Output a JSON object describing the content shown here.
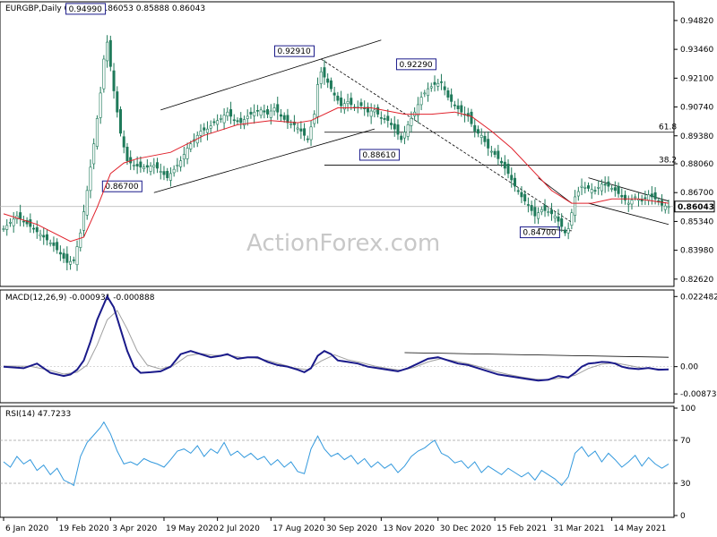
{
  "header": {
    "main_title": "EURGBP,Daily  0.85905 0.86053 0.85888 0.86043",
    "macd_title": "MACD(12,26,9) -0.000931 -0.000888",
    "rsi_title": "RSI(14) 47.7233"
  },
  "watermark": "ActionForex.com",
  "colors": {
    "candle": "#1f7a5a",
    "sma": "#e0202a",
    "macd_line": "#1a1a8a",
    "signal_line": "#a0a0a0",
    "rsi_line": "#3399dd",
    "trendline": "#000000",
    "fib_line": "#000000"
  },
  "chart_data": [
    {
      "type": "candlestick",
      "x_labels": [
        "6 Jan 2020",
        "19 Feb 2020",
        "3 Apr 2020",
        "19 May 2020",
        "2 Jul 2020",
        "17 Aug 2020",
        "30 Sep 2020",
        "13 Nov 2020",
        "30 Dec 2020",
        "15 Feb 2021",
        "31 Mar 2021",
        "14 May 2021"
      ],
      "y_ticks": [
        "0.94820",
        "0.93460",
        "0.92100",
        "0.90740",
        "0.89380",
        "0.88060",
        "0.86700",
        "0.85340",
        "0.83980",
        "0.82620"
      ],
      "ylim": [
        0.8236,
        0.9545
      ],
      "current_price_label": "0.86043",
      "close_path": [
        [
          0,
          0.85
        ],
        [
          4,
          0.856
        ],
        [
          8,
          0.851
        ],
        [
          12,
          0.846
        ],
        [
          15,
          0.842
        ],
        [
          17,
          0.838
        ],
        [
          19,
          0.834
        ],
        [
          21,
          0.835
        ],
        [
          23,
          0.848
        ],
        [
          25,
          0.868
        ],
        [
          27,
          0.89
        ],
        [
          29,
          0.914
        ],
        [
          30,
          0.93
        ],
        [
          31,
          0.938
        ],
        [
          33,
          0.915
        ],
        [
          35,
          0.895
        ],
        [
          37,
          0.882
        ],
        [
          39,
          0.88
        ],
        [
          41,
          0.879
        ],
        [
          43,
          0.879
        ],
        [
          45,
          0.88
        ],
        [
          47,
          0.877
        ],
        [
          49,
          0.874
        ],
        [
          51,
          0.878
        ],
        [
          53,
          0.882
        ],
        [
          55,
          0.888
        ],
        [
          57,
          0.892
        ],
        [
          59,
          0.896
        ],
        [
          61,
          0.897
        ],
        [
          63,
          0.9
        ],
        [
          65,
          0.902
        ],
        [
          67,
          0.905
        ],
        [
          69,
          0.901
        ],
        [
          71,
          0.9
        ],
        [
          73,
          0.903
        ],
        [
          75,
          0.905
        ],
        [
          77,
          0.906
        ],
        [
          79,
          0.904
        ],
        [
          81,
          0.907
        ],
        [
          83,
          0.903
        ],
        [
          85,
          0.9
        ],
        [
          87,
          0.899
        ],
        [
          89,
          0.896
        ],
        [
          91,
          0.892
        ],
        [
          93,
          0.904
        ],
        [
          94,
          0.918
        ],
        [
          95,
          0.924
        ],
        [
          97,
          0.919
        ],
        [
          99,
          0.913
        ],
        [
          101,
          0.908
        ],
        [
          103,
          0.91
        ],
        [
          105,
          0.907
        ],
        [
          107,
          0.908
        ],
        [
          109,
          0.905
        ],
        [
          111,
          0.906
        ],
        [
          113,
          0.902
        ],
        [
          115,
          0.901
        ],
        [
          117,
          0.897
        ],
        [
          119,
          0.892
        ],
        [
          121,
          0.899
        ],
        [
          123,
          0.905
        ],
        [
          125,
          0.912
        ],
        [
          127,
          0.916
        ],
        [
          129,
          0.918
        ],
        [
          131,
          0.919
        ],
        [
          133,
          0.912
        ],
        [
          135,
          0.908
        ],
        [
          137,
          0.905
        ],
        [
          139,
          0.903
        ],
        [
          141,
          0.896
        ],
        [
          143,
          0.894
        ],
        [
          145,
          0.888
        ],
        [
          147,
          0.885
        ],
        [
          149,
          0.881
        ],
        [
          151,
          0.876
        ],
        [
          153,
          0.87
        ],
        [
          155,
          0.865
        ],
        [
          157,
          0.861
        ],
        [
          159,
          0.856
        ],
        [
          161,
          0.859
        ],
        [
          163,
          0.858
        ],
        [
          165,
          0.856
        ],
        [
          167,
          0.851
        ],
        [
          168,
          0.848
        ],
        [
          169,
          0.85
        ],
        [
          171,
          0.865
        ],
        [
          173,
          0.87
        ],
        [
          175,
          0.869
        ],
        [
          177,
          0.868
        ],
        [
          179,
          0.871
        ],
        [
          181,
          0.87
        ],
        [
          183,
          0.868
        ],
        [
          185,
          0.865
        ],
        [
          187,
          0.862
        ],
        [
          189,
          0.865
        ],
        [
          191,
          0.863
        ],
        [
          193,
          0.866
        ],
        [
          195,
          0.864
        ],
        [
          197,
          0.861
        ],
        [
          199,
          0.8604
        ]
      ],
      "sma_path": [
        [
          0,
          0.857
        ],
        [
          10,
          0.852
        ],
        [
          20,
          0.844
        ],
        [
          24,
          0.846
        ],
        [
          28,
          0.86
        ],
        [
          32,
          0.876
        ],
        [
          36,
          0.881
        ],
        [
          40,
          0.883
        ],
        [
          50,
          0.886
        ],
        [
          60,
          0.894
        ],
        [
          70,
          0.899
        ],
        [
          80,
          0.901
        ],
        [
          88,
          0.9
        ],
        [
          92,
          0.901
        ],
        [
          100,
          0.907
        ],
        [
          110,
          0.907
        ],
        [
          120,
          0.904
        ],
        [
          128,
          0.904
        ],
        [
          135,
          0.905
        ],
        [
          140,
          0.903
        ],
        [
          146,
          0.896
        ],
        [
          152,
          0.888
        ],
        [
          158,
          0.878
        ],
        [
          164,
          0.868
        ],
        [
          170,
          0.862
        ],
        [
          176,
          0.862
        ],
        [
          182,
          0.864
        ],
        [
          190,
          0.864
        ],
        [
          199,
          0.862
        ]
      ],
      "annotations": [
        "0.94990",
        "0.92910",
        "0.92290",
        "0.88610",
        "0.86700",
        "0.84700"
      ],
      "fib_labels": [
        "61.8",
        "38.2"
      ]
    },
    {
      "type": "line",
      "title": "MACD(12,26,9)",
      "y_ticks": [
        "0.022482",
        "0.00",
        "-0.008736"
      ],
      "ylim": [
        -0.011,
        0.024
      ],
      "macd": [
        [
          0,
          0.0
        ],
        [
          6,
          -0.0005
        ],
        [
          10,
          0.001
        ],
        [
          14,
          -0.002
        ],
        [
          18,
          -0.003
        ],
        [
          20,
          -0.0025
        ],
        [
          22,
          -0.001
        ],
        [
          24,
          0.002
        ],
        [
          26,
          0.008
        ],
        [
          28,
          0.015
        ],
        [
          30,
          0.02
        ],
        [
          31,
          0.0225
        ],
        [
          33,
          0.019
        ],
        [
          35,
          0.012
        ],
        [
          37,
          0.005
        ],
        [
          39,
          0.0
        ],
        [
          41,
          -0.002
        ],
        [
          44,
          -0.0018
        ],
        [
          47,
          -0.0015
        ],
        [
          50,
          0.0
        ],
        [
          53,
          0.004
        ],
        [
          56,
          0.005
        ],
        [
          59,
          0.004
        ],
        [
          62,
          0.003
        ],
        [
          65,
          0.0035
        ],
        [
          67,
          0.004
        ],
        [
          70,
          0.0025
        ],
        [
          73,
          0.003
        ],
        [
          76,
          0.003
        ],
        [
          79,
          0.0015
        ],
        [
          82,
          0.0005
        ],
        [
          85,
          0.0
        ],
        [
          88,
          -0.001
        ],
        [
          90,
          -0.0018
        ],
        [
          92,
          -0.0005
        ],
        [
          94,
          0.0035
        ],
        [
          96,
          0.005
        ],
        [
          98,
          0.004
        ],
        [
          100,
          0.002
        ],
        [
          103,
          0.0015
        ],
        [
          106,
          0.001
        ],
        [
          109,
          0.0
        ],
        [
          112,
          -0.0005
        ],
        [
          115,
          -0.001
        ],
        [
          118,
          -0.0015
        ],
        [
          121,
          -0.0005
        ],
        [
          124,
          0.001
        ],
        [
          127,
          0.0025
        ],
        [
          130,
          0.003
        ],
        [
          133,
          0.002
        ],
        [
          136,
          0.001
        ],
        [
          139,
          0.0005
        ],
        [
          142,
          -0.0005
        ],
        [
          145,
          -0.0015
        ],
        [
          148,
          -0.0025
        ],
        [
          151,
          -0.003
        ],
        [
          154,
          -0.0035
        ],
        [
          157,
          -0.004
        ],
        [
          160,
          -0.0045
        ],
        [
          163,
          -0.0042
        ],
        [
          166,
          -0.003
        ],
        [
          169,
          -0.0035
        ],
        [
          171,
          -0.002
        ],
        [
          173,
          0.0
        ],
        [
          175,
          0.001
        ],
        [
          177,
          0.0012
        ],
        [
          179,
          0.0015
        ],
        [
          181,
          0.0014
        ],
        [
          183,
          0.001
        ],
        [
          185,
          0.0
        ],
        [
          187,
          -0.0005
        ],
        [
          190,
          -0.0008
        ],
        [
          193,
          -0.0004
        ],
        [
          196,
          -0.001
        ],
        [
          199,
          -0.0009
        ]
      ],
      "signal": [
        [
          0,
          0.0002
        ],
        [
          8,
          0.0001
        ],
        [
          14,
          -0.0012
        ],
        [
          18,
          -0.0024
        ],
        [
          22,
          -0.0018
        ],
        [
          25,
          0.0005
        ],
        [
          28,
          0.007
        ],
        [
          31,
          0.015
        ],
        [
          34,
          0.018
        ],
        [
          37,
          0.012
        ],
        [
          40,
          0.005
        ],
        [
          43,
          0.0005
        ],
        [
          47,
          -0.0008
        ],
        [
          51,
          0.0005
        ],
        [
          55,
          0.0035
        ],
        [
          59,
          0.0042
        ],
        [
          63,
          0.0036
        ],
        [
          67,
          0.0037
        ],
        [
          71,
          0.003
        ],
        [
          75,
          0.0028
        ],
        [
          79,
          0.002
        ],
        [
          83,
          0.0008
        ],
        [
          87,
          -0.0004
        ],
        [
          91,
          -0.001
        ],
        [
          95,
          0.0018
        ],
        [
          99,
          0.0038
        ],
        [
          103,
          0.0022
        ],
        [
          107,
          0.0013
        ],
        [
          111,
          0.0002
        ],
        [
          115,
          -0.0006
        ],
        [
          119,
          -0.0012
        ],
        [
          123,
          -0.0002
        ],
        [
          127,
          0.0015
        ],
        [
          131,
          0.0026
        ],
        [
          135,
          0.0018
        ],
        [
          139,
          0.0009
        ],
        [
          143,
          -0.0002
        ],
        [
          147,
          -0.0015
        ],
        [
          151,
          -0.0025
        ],
        [
          155,
          -0.0033
        ],
        [
          159,
          -0.004
        ],
        [
          163,
          -0.0042
        ],
        [
          167,
          -0.0036
        ],
        [
          171,
          -0.0028
        ],
        [
          175,
          -0.0006
        ],
        [
          179,
          0.0008
        ],
        [
          183,
          0.0012
        ],
        [
          187,
          0.0004
        ],
        [
          191,
          -0.0004
        ],
        [
          195,
          -0.0007
        ],
        [
          199,
          -0.0009
        ]
      ]
    },
    {
      "type": "line",
      "title": "RSI(14)",
      "y_ticks": [
        "100",
        "70",
        "30",
        "0"
      ],
      "ylim": [
        0,
        100
      ],
      "rsi": [
        [
          0,
          50
        ],
        [
          2,
          45
        ],
        [
          4,
          55
        ],
        [
          6,
          48
        ],
        [
          8,
          52
        ],
        [
          10,
          42
        ],
        [
          12,
          47
        ],
        [
          14,
          38
        ],
        [
          16,
          44
        ],
        [
          18,
          33
        ],
        [
          20,
          30
        ],
        [
          21,
          28
        ],
        [
          23,
          55
        ],
        [
          25,
          68
        ],
        [
          27,
          75
        ],
        [
          29,
          82
        ],
        [
          30,
          87
        ],
        [
          32,
          76
        ],
        [
          34,
          60
        ],
        [
          36,
          48
        ],
        [
          38,
          50
        ],
        [
          40,
          47
        ],
        [
          42,
          53
        ],
        [
          44,
          50
        ],
        [
          46,
          48
        ],
        [
          48,
          45
        ],
        [
          50,
          52
        ],
        [
          52,
          60
        ],
        [
          54,
          62
        ],
        [
          56,
          58
        ],
        [
          58,
          65
        ],
        [
          60,
          55
        ],
        [
          62,
          62
        ],
        [
          64,
          58
        ],
        [
          66,
          68
        ],
        [
          68,
          56
        ],
        [
          70,
          60
        ],
        [
          72,
          54
        ],
        [
          74,
          58
        ],
        [
          76,
          52
        ],
        [
          78,
          55
        ],
        [
          80,
          47
        ],
        [
          82,
          52
        ],
        [
          84,
          45
        ],
        [
          86,
          50
        ],
        [
          88,
          41
        ],
        [
          90,
          39
        ],
        [
          92,
          62
        ],
        [
          94,
          74
        ],
        [
          96,
          62
        ],
        [
          98,
          55
        ],
        [
          100,
          58
        ],
        [
          102,
          52
        ],
        [
          104,
          56
        ],
        [
          106,
          48
        ],
        [
          108,
          53
        ],
        [
          110,
          45
        ],
        [
          112,
          50
        ],
        [
          114,
          44
        ],
        [
          116,
          48
        ],
        [
          118,
          40
        ],
        [
          120,
          46
        ],
        [
          122,
          55
        ],
        [
          124,
          60
        ],
        [
          126,
          63
        ],
        [
          128,
          68
        ],
        [
          129,
          70
        ],
        [
          131,
          58
        ],
        [
          133,
          55
        ],
        [
          135,
          49
        ],
        [
          137,
          51
        ],
        [
          139,
          44
        ],
        [
          141,
          50
        ],
        [
          143,
          40
        ],
        [
          145,
          46
        ],
        [
          147,
          42
        ],
        [
          149,
          38
        ],
        [
          151,
          44
        ],
        [
          153,
          40
        ],
        [
          155,
          36
        ],
        [
          157,
          40
        ],
        [
          159,
          33
        ],
        [
          161,
          42
        ],
        [
          163,
          38
        ],
        [
          165,
          34
        ],
        [
          167,
          28
        ],
        [
          169,
          36
        ],
        [
          171,
          58
        ],
        [
          173,
          64
        ],
        [
          175,
          55
        ],
        [
          177,
          60
        ],
        [
          179,
          50
        ],
        [
          181,
          58
        ],
        [
          183,
          52
        ],
        [
          185,
          45
        ],
        [
          187,
          50
        ],
        [
          189,
          56
        ],
        [
          191,
          46
        ],
        [
          193,
          54
        ],
        [
          195,
          48
        ],
        [
          197,
          44
        ],
        [
          199,
          48
        ]
      ]
    }
  ]
}
